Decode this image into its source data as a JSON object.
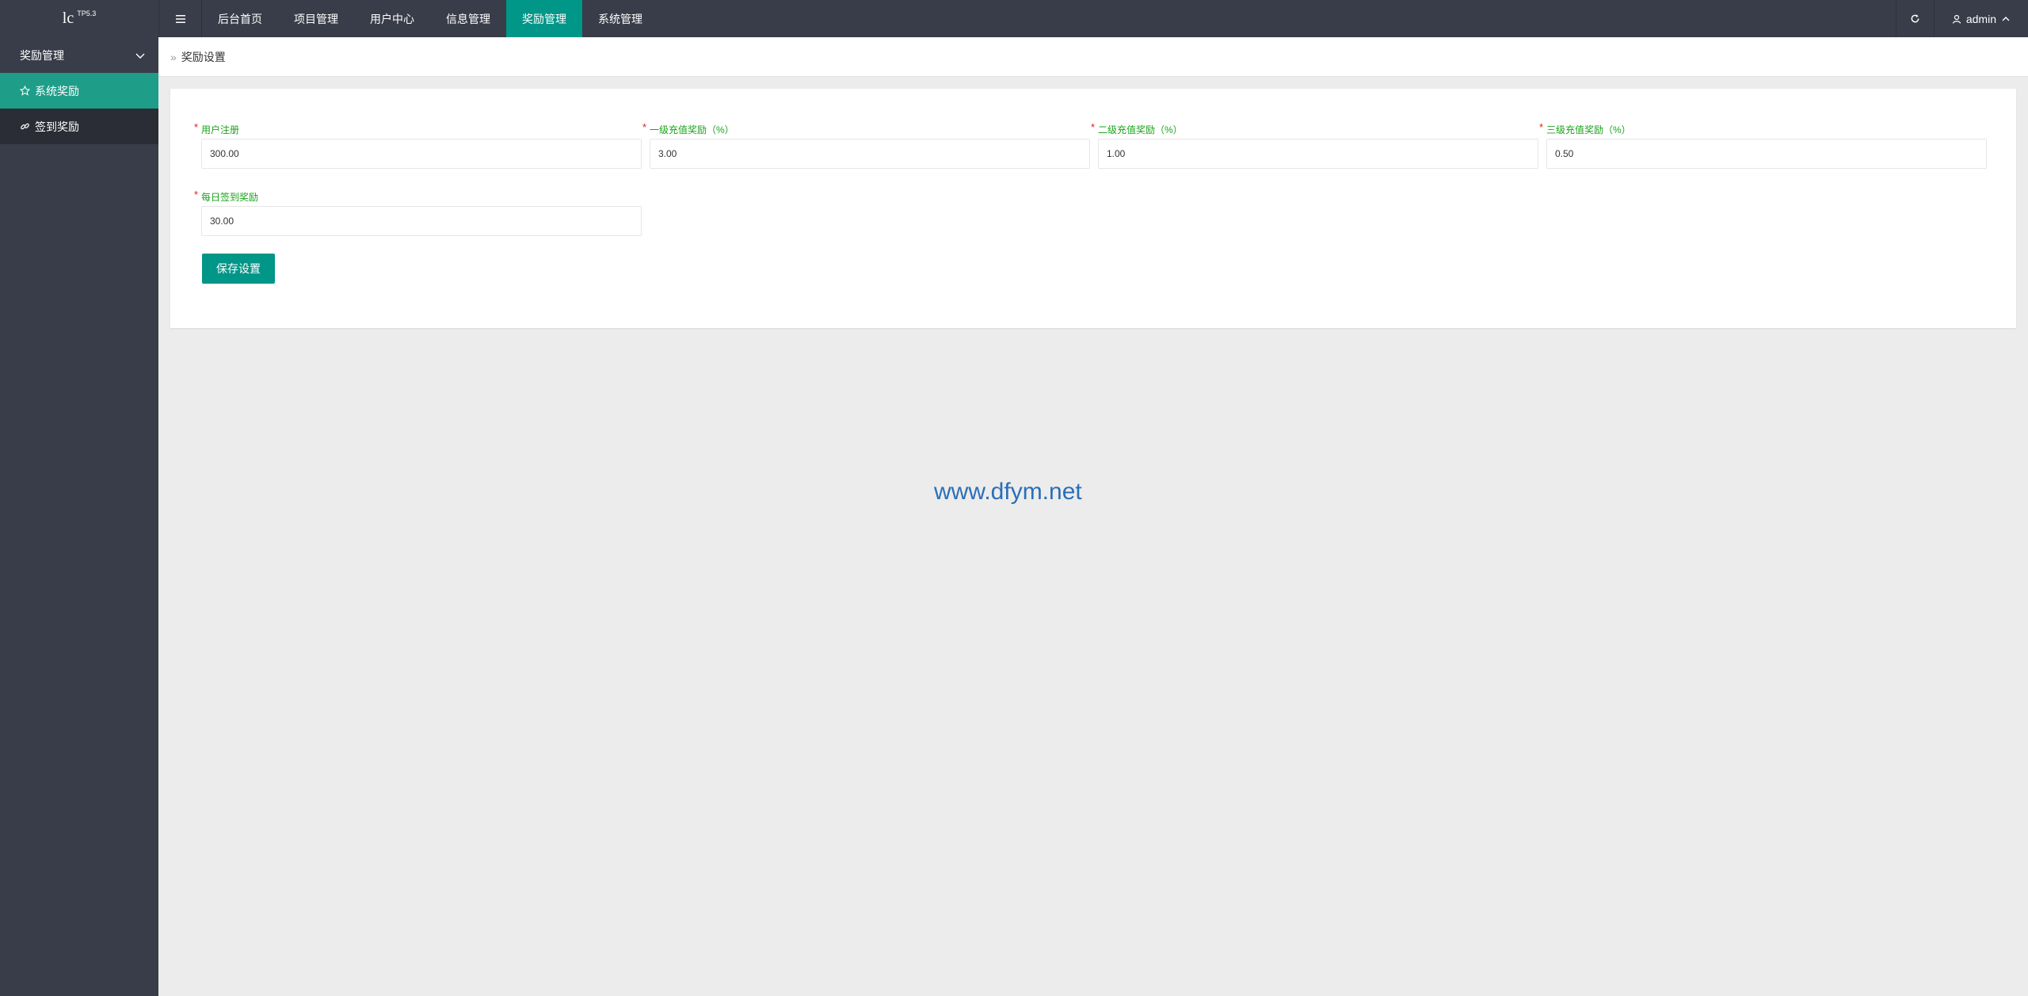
{
  "app": {
    "logo_main": "lc",
    "logo_sup": "TP5.3"
  },
  "topnav": {
    "items": [
      {
        "label": "后台首页"
      },
      {
        "label": "项目管理"
      },
      {
        "label": "用户中心"
      },
      {
        "label": "信息管理"
      },
      {
        "label": "奖励管理",
        "active": true
      },
      {
        "label": "系统管理"
      }
    ],
    "user": "admin",
    "icons": {
      "menu": "hamburger-icon",
      "refresh": "refresh-icon",
      "user": "user-icon",
      "caret": "chevron-up-icon"
    }
  },
  "sidebar": {
    "section_title": "奖励管理",
    "items": [
      {
        "label": "系统奖励",
        "icon": "star-icon",
        "active": true
      },
      {
        "label": "签到奖励",
        "icon": "link-icon"
      }
    ]
  },
  "breadcrumb": {
    "separator": "»",
    "current": "奖励设置"
  },
  "form": {
    "fields": [
      {
        "label": "用户注册",
        "value": "300.00",
        "required": true
      },
      {
        "label": "一级充值奖励（%）",
        "value": "3.00",
        "required": true
      },
      {
        "label": "二级充值奖励（%）",
        "value": "1.00",
        "required": true
      },
      {
        "label": "三级充值奖励（%）",
        "value": "0.50",
        "required": true
      },
      {
        "label": "每日签到奖励",
        "value": "30.00",
        "required": true
      }
    ],
    "required_mark": "*",
    "save_label": "保存设置"
  },
  "watermark": "www.dfym.net",
  "colors": {
    "header_bg": "#393d49",
    "accent": "#009688",
    "label_green": "#1aa31a",
    "required_red": "#e41919"
  }
}
